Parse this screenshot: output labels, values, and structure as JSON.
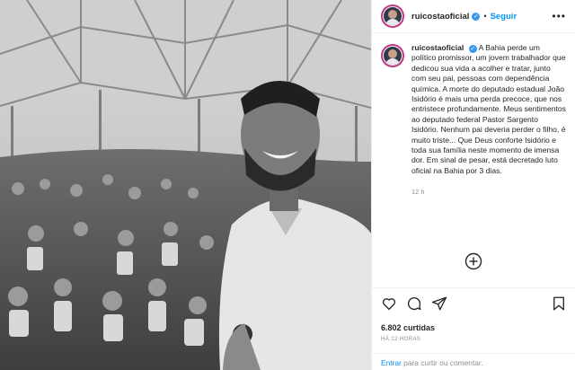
{
  "post": {
    "username": "ruicostaoficial",
    "verified_icon": "verified-badge-icon",
    "follow_label": "Seguir",
    "separator": "•",
    "more_icon": "more-options-icon",
    "caption_username": "ruicostaoficial",
    "caption_text": "A Bahia perde um político promissor, um jovem trabalhador que dedicou sua vida a acolher e tratar, junto com seu pai, pessoas com dependência química. A morte do deputado estadual João Isidório é mais uma perda precoce, que nos entristece profundamente. Meus sentimentos ao deputado federal Pastor Sargento Isidório. Nenhum pai deveria perder o filho, é muito triste... Que Deus conforte Isidório e toda sua família neste momento de imensa dor. Em sinal de pesar, está decretado luto oficial na Bahia por 3 dias.",
    "caption_time": "12 h",
    "likes": "6.802 curtidas",
    "posted_ago": "HÁ 12 HORAS",
    "comment_link": "Entrar",
    "comment_rest": " para curtir ou comentar.",
    "colors": {
      "link": "#0095f6",
      "muted": "#8e8e8e",
      "text": "#262626"
    }
  }
}
